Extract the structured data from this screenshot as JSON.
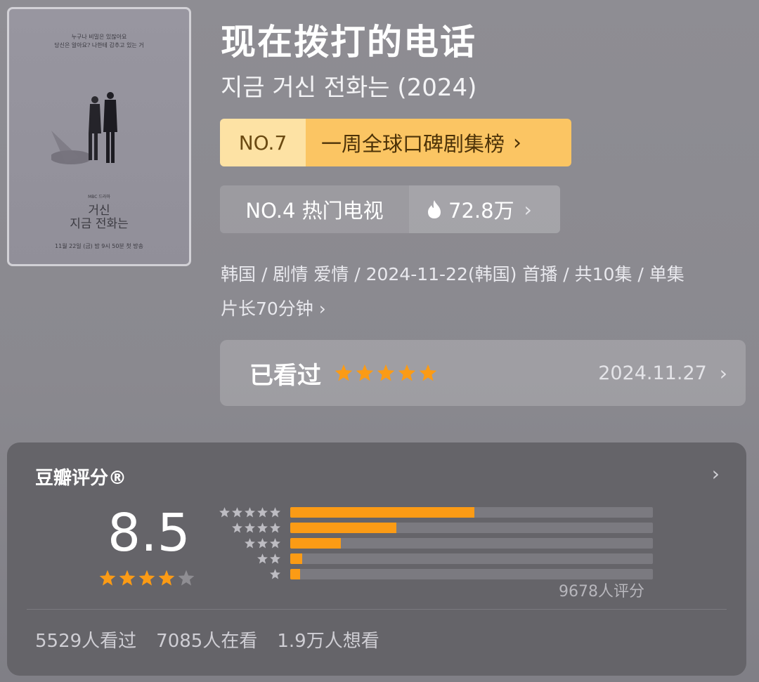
{
  "poster": {
    "tagline_1": "누구나 비밀은 있잖아요",
    "tagline_2": "당신은 알아요? 나한테 감추고 있는 거",
    "brand": "MBC 드라마",
    "title_line1": "거신",
    "title_line2": "지금 전화는",
    "air_info": "11월 22일 (금) 밤 9시 50분 첫 방송"
  },
  "header": {
    "title": "现在拨打的电话",
    "subtitle": "지금 거신 전화는 (2024)"
  },
  "rank_weekly": {
    "number": "NO.7",
    "label": "一周全球口碑剧集榜",
    "chevron": "›"
  },
  "rank_hot": {
    "number": "NO.4 热门电视",
    "heat": "72.8万",
    "icon": "flame-icon",
    "chevron": "›"
  },
  "meta": {
    "line1": "韩国 / 剧情 爱情 / 2024-11-22(韩国) 首播 / 共10集 / 单集",
    "line2": "片长70分钟",
    "chevron": "›"
  },
  "watched": {
    "label": "已看过",
    "user_rating_stars": 5,
    "date": "2024.11.27",
    "chevron": "›"
  },
  "rating": {
    "heading": "豆瓣评分®",
    "score": "8.5",
    "score_stars": 4,
    "distribution": [
      {
        "stars": 5,
        "percent": 50.7
      },
      {
        "stars": 4,
        "percent": 29.3
      },
      {
        "stars": 3,
        "percent": 14.0
      },
      {
        "stars": 2,
        "percent": 3.3
      },
      {
        "stars": 1,
        "percent": 2.7
      }
    ],
    "count_text": "9678人评分",
    "chevron": "›",
    "stats": {
      "watched": "5529人看过",
      "watching": "7085人在看",
      "want": "1.9万人想看"
    }
  },
  "colors": {
    "accent_orange": "#fb9b15",
    "badge_gold": "#fbc563",
    "star_gray": "#8f8e93"
  }
}
